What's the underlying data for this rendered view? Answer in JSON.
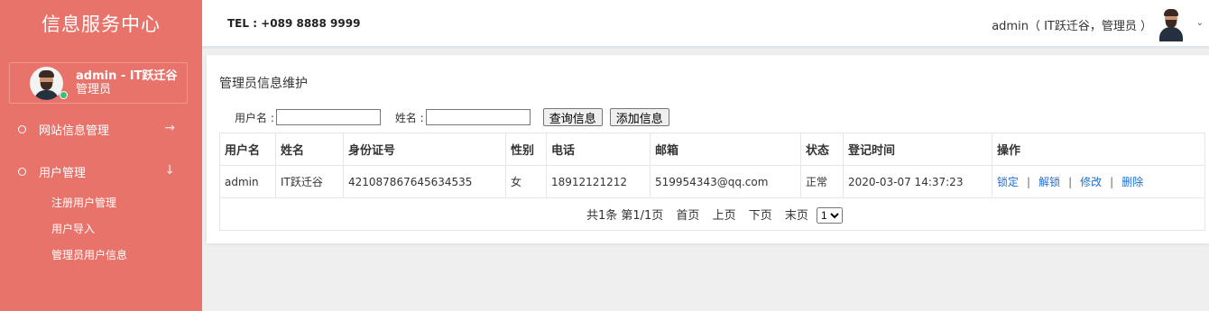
{
  "sidebar": {
    "brand": "信息服务中心",
    "user": {
      "name": "admin - IT跃迁谷",
      "role": "管理员"
    },
    "menu": [
      {
        "label": "网站信息管理",
        "arrow": "→"
      },
      {
        "label": "用户管理",
        "arrow": "↓"
      }
    ],
    "submenu": [
      "注册用户管理",
      "用户导入",
      "管理员用户信息"
    ]
  },
  "header": {
    "tel": "TEL : +089 8888 9999",
    "user": "admin（ IT跃迁谷，管理员 ）",
    "caret": "⌄"
  },
  "panel": {
    "title": "管理员信息维护",
    "search": {
      "username_label": "用户名 :",
      "name_label": "姓名 :",
      "query_button": "查询信息",
      "add_button": "添加信息"
    },
    "table": {
      "headers": [
        "用户名",
        "姓名",
        "身份证号",
        "性别",
        "电话",
        "邮箱",
        "状态",
        "登记时间",
        "操作"
      ],
      "rows": [
        {
          "username": "admin",
          "name": "IT跃迁谷",
          "id_card": "421087867645634535",
          "gender": "女",
          "phone": "18912121212",
          "email": "519954343@qq.com",
          "status": "正常",
          "time": "2020-03-07 14:37:23",
          "actions": {
            "lock": "锁定",
            "unlock": "解锁",
            "edit": "修改",
            "delete": "删除",
            "sep": "|"
          }
        }
      ]
    },
    "pager": {
      "summary": "共1条 第1/1页",
      "first": "首页",
      "prev": "上页",
      "next": "下页",
      "last": "末页",
      "page": "1"
    }
  }
}
